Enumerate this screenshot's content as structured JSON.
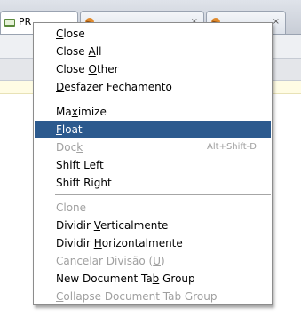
{
  "tabs": [
    {
      "label": "PR",
      "close": ""
    },
    {
      "label": "",
      "close": "×"
    },
    {
      "label": "",
      "close": "×"
    }
  ],
  "menu": {
    "items": [
      {
        "id": "close",
        "pre": "",
        "mn": "C",
        "post": "lose",
        "enabled": true,
        "selected": false,
        "shortcut": ""
      },
      {
        "id": "close-all",
        "pre": "Close ",
        "mn": "A",
        "post": "ll",
        "enabled": true,
        "selected": false,
        "shortcut": ""
      },
      {
        "id": "close-other",
        "pre": "Close ",
        "mn": "O",
        "post": "ther",
        "enabled": true,
        "selected": false,
        "shortcut": ""
      },
      {
        "id": "desfazer",
        "pre": "",
        "mn": "D",
        "post": "esfazer Fechamento",
        "enabled": true,
        "selected": false,
        "shortcut": ""
      },
      {
        "id": "maximize",
        "pre": "Ma",
        "mn": "x",
        "post": "imize",
        "enabled": true,
        "selected": false,
        "shortcut": ""
      },
      {
        "id": "float",
        "pre": "",
        "mn": "F",
        "post": "loat",
        "enabled": true,
        "selected": true,
        "shortcut": ""
      },
      {
        "id": "dock",
        "pre": "Doc",
        "mn": "k",
        "post": "",
        "enabled": false,
        "selected": false,
        "shortcut": "Alt+Shift-D"
      },
      {
        "id": "shift-left",
        "pre": "Shift Left",
        "mn": "",
        "post": "",
        "enabled": true,
        "selected": false,
        "shortcut": ""
      },
      {
        "id": "shift-right",
        "pre": "Shift Right",
        "mn": "",
        "post": "",
        "enabled": true,
        "selected": false,
        "shortcut": ""
      },
      {
        "id": "clone",
        "pre": "Clone",
        "mn": "",
        "post": "",
        "enabled": false,
        "selected": false,
        "shortcut": ""
      },
      {
        "id": "dividir-vert",
        "pre": "Dividir ",
        "mn": "V",
        "post": "erticalmente",
        "enabled": true,
        "selected": false,
        "shortcut": ""
      },
      {
        "id": "dividir-horiz",
        "pre": "Dividir ",
        "mn": "H",
        "post": "orizontalmente",
        "enabled": true,
        "selected": false,
        "shortcut": ""
      },
      {
        "id": "cancelar",
        "pre": "Cancelar Divisão (",
        "mn": "U",
        "post": ")",
        "enabled": false,
        "selected": false,
        "shortcut": ""
      },
      {
        "id": "new-group",
        "pre": "New Document Ta",
        "mn": "b",
        "post": " Group",
        "enabled": true,
        "selected": false,
        "shortcut": ""
      },
      {
        "id": "collapse-group",
        "pre": "",
        "mn": "C",
        "post": "ollapse Document Tab Group",
        "enabled": false,
        "selected": false,
        "shortcut": ""
      }
    ]
  }
}
